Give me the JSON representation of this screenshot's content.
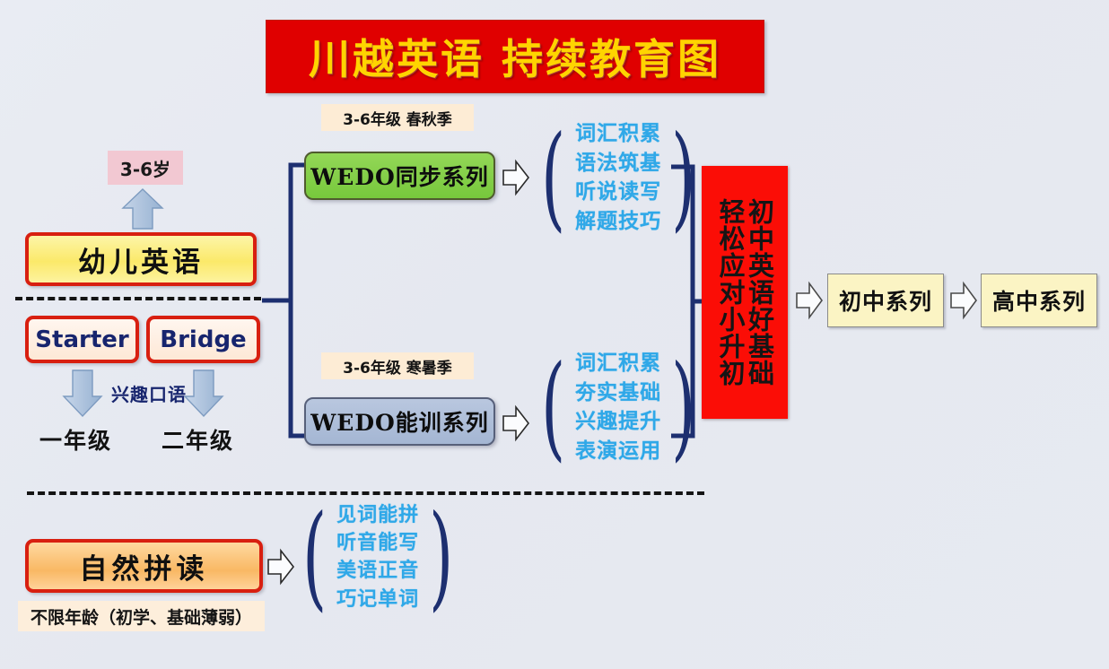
{
  "title": {
    "text": "川越英语 持续教育图",
    "bg_color": "#e00000",
    "text_color": "#ffd400"
  },
  "left_column": {
    "age_badge": "3-6岁",
    "kids_english": "幼儿英语",
    "levels": [
      {
        "label": "Starter",
        "grade": "一年级"
      },
      {
        "label": "Bridge",
        "grade": "二年级"
      }
    ],
    "oral_note": "兴趣口语"
  },
  "phonics": {
    "box_label": "自然拼读",
    "note": "不限年龄（初学、基础薄弱）",
    "outcomes": [
      "见词能拼",
      "听音能写",
      "美语正音",
      "巧记单词"
    ]
  },
  "tracks": [
    {
      "tag": "3-6年级  春秋季",
      "course": "WEDO同步系列",
      "color": "#85cf4a",
      "outcomes": [
        "词汇积累",
        "语法筑基",
        "听说读写",
        "解题技巧"
      ]
    },
    {
      "tag": "3-6年级  寒暑季",
      "course": "WEDO能训系列",
      "color": "#adbed8",
      "outcomes": [
        "词汇积累",
        "夯实基础",
        "兴趣提升",
        "表演运用"
      ]
    }
  ],
  "outcome_box": {
    "line_right": "初中英语好基础",
    "line_left": "轻松应对小升初",
    "bg_color": "#fb0d06"
  },
  "series": [
    {
      "label": "初中系列"
    },
    {
      "label": "高中系列"
    }
  ],
  "icons": {
    "up_arrow": "up-arrow-icon",
    "down_arrow": "down-arrow-icon",
    "right_arrow": "right-arrow-icon",
    "bracket": "bracket-connector-icon"
  }
}
